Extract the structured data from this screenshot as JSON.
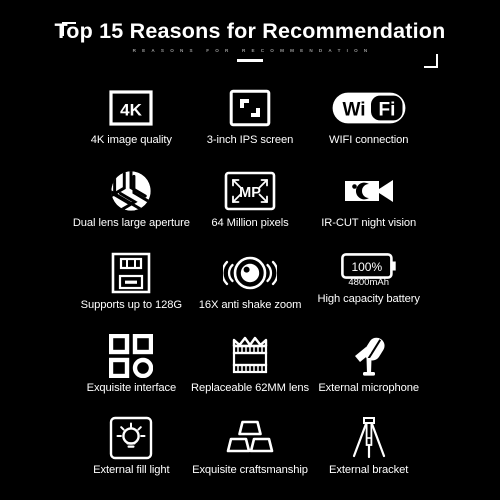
{
  "header": {
    "title": "Top 15 Reasons for Recommendation",
    "subtitle": "REASONS FOR RECOMMENDATION"
  },
  "features": [
    [
      {
        "icon": "4k-box-icon",
        "label": "4K image quality",
        "icon_text": "4K"
      },
      {
        "icon": "screen-frame-icon",
        "label": "3-inch IPS screen"
      },
      {
        "icon": "wifi-pill-icon",
        "label": "WIFI connection",
        "icon_text_left": "Wi",
        "icon_text_right": "Fi"
      }
    ],
    [
      {
        "icon": "aperture-icon",
        "label": "Dual lens large aperture"
      },
      {
        "icon": "megapixel-icon",
        "label": "64 Million pixels",
        "icon_text": "MP"
      },
      {
        "icon": "night-vision-camcorder-icon",
        "label": "IR-CUT night vision"
      }
    ],
    [
      {
        "icon": "sd-card-icon",
        "label": "Supports up to 128G"
      },
      {
        "icon": "anti-shake-zoom-icon",
        "label": "16X anti shake zoom"
      },
      {
        "icon": "battery-icon",
        "label": "High capacity battery",
        "icon_text": "100%",
        "note": "4800mAh"
      }
    ],
    [
      {
        "icon": "interface-grid-icon",
        "label": "Exquisite interface"
      },
      {
        "icon": "camera-lens-icon",
        "label": "Replaceable 62MM lens"
      },
      {
        "icon": "microphone-icon",
        "label": "External microphone"
      }
    ],
    [
      {
        "icon": "fill-light-icon",
        "label": "External fill light"
      },
      {
        "icon": "gold-bars-icon",
        "label": "Exquisite craftsmanship"
      },
      {
        "icon": "tripod-icon",
        "label": "External bracket"
      }
    ]
  ],
  "colors": {
    "background": "#000000",
    "foreground": "#ffffff",
    "subtitle": "#9a9a9a"
  }
}
